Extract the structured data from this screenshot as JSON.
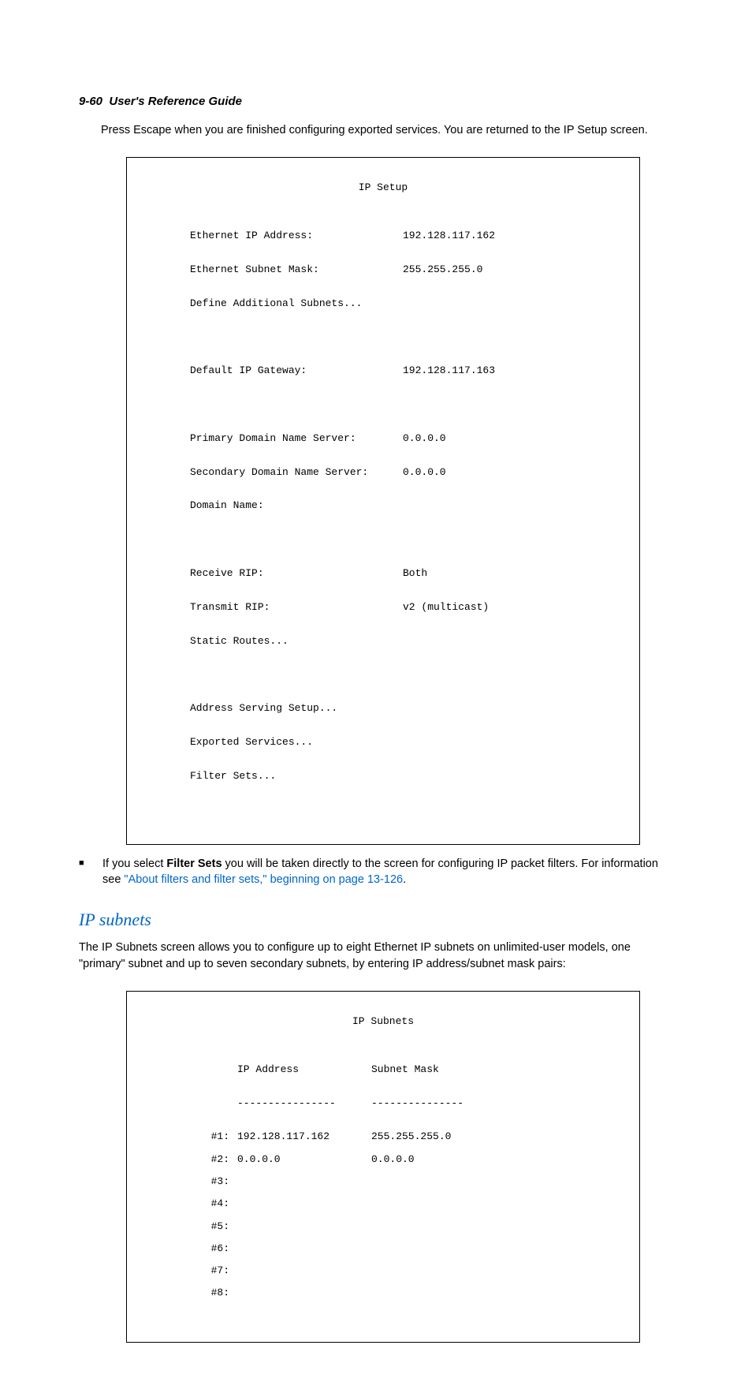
{
  "header": {
    "section": "9-60",
    "title": "User's Reference Guide"
  },
  "intro_text": "Press Escape when you are finished configuring exported services. You are returned to the IP Setup screen.",
  "ip_setup": {
    "title": "IP Setup",
    "rows": [
      {
        "label": "Ethernet IP Address:",
        "value": "192.128.117.162"
      },
      {
        "label": "Ethernet Subnet Mask:",
        "value": "255.255.255.0"
      },
      {
        "label": "Define Additional Subnets...",
        "value": ""
      }
    ],
    "gateway": {
      "label": "Default IP Gateway:",
      "value": "192.128.117.163"
    },
    "dns": [
      {
        "label": "Primary Domain Name Server:",
        "value": "0.0.0.0"
      },
      {
        "label": "Secondary Domain Name Server:",
        "value": "0.0.0.0"
      },
      {
        "label": "Domain Name:",
        "value": ""
      }
    ],
    "rip": [
      {
        "label": "Receive RIP:",
        "value": "Both"
      },
      {
        "label": "Transmit RIP:",
        "value": "v2 (multicast)"
      },
      {
        "label": "Static Routes...",
        "value": ""
      }
    ],
    "bottom": [
      {
        "label": "Address Serving Setup...",
        "value": ""
      },
      {
        "label": "Exported Services...",
        "value": ""
      },
      {
        "label": "Filter Sets...",
        "value": ""
      }
    ]
  },
  "bullet": {
    "prefix": "If you select ",
    "bold": "Filter Sets",
    "mid": " you will be taken directly to the screen for configuring IP packet filters. For information see ",
    "link": "\"About filters and filter sets,\" beginning on page 13-126",
    "suffix": "."
  },
  "section_heading": "IP subnets",
  "section_text": "The IP Subnets screen allows you to configure up to eight Ethernet IP subnets on unlimited-user models, one \"primary\" subnet and up to seven secondary subnets, by entering IP address/subnet mask pairs:",
  "ip_subnets": {
    "title": "IP Subnets",
    "col1": "IP Address",
    "col2": "Subnet Mask",
    "dash1": "----------------",
    "dash2": "---------------",
    "rows": [
      {
        "num": "#1:",
        "ip": "192.128.117.162",
        "mask": "255.255.255.0"
      },
      {
        "num": "#2:",
        "ip": "0.0.0.0",
        "mask": "0.0.0.0"
      },
      {
        "num": "#3:",
        "ip": "",
        "mask": ""
      },
      {
        "num": "#4:",
        "ip": "",
        "mask": ""
      },
      {
        "num": "#5:",
        "ip": "",
        "mask": ""
      },
      {
        "num": "#6:",
        "ip": "",
        "mask": ""
      },
      {
        "num": "#7:",
        "ip": "",
        "mask": ""
      },
      {
        "num": "#8:",
        "ip": "",
        "mask": ""
      }
    ]
  }
}
